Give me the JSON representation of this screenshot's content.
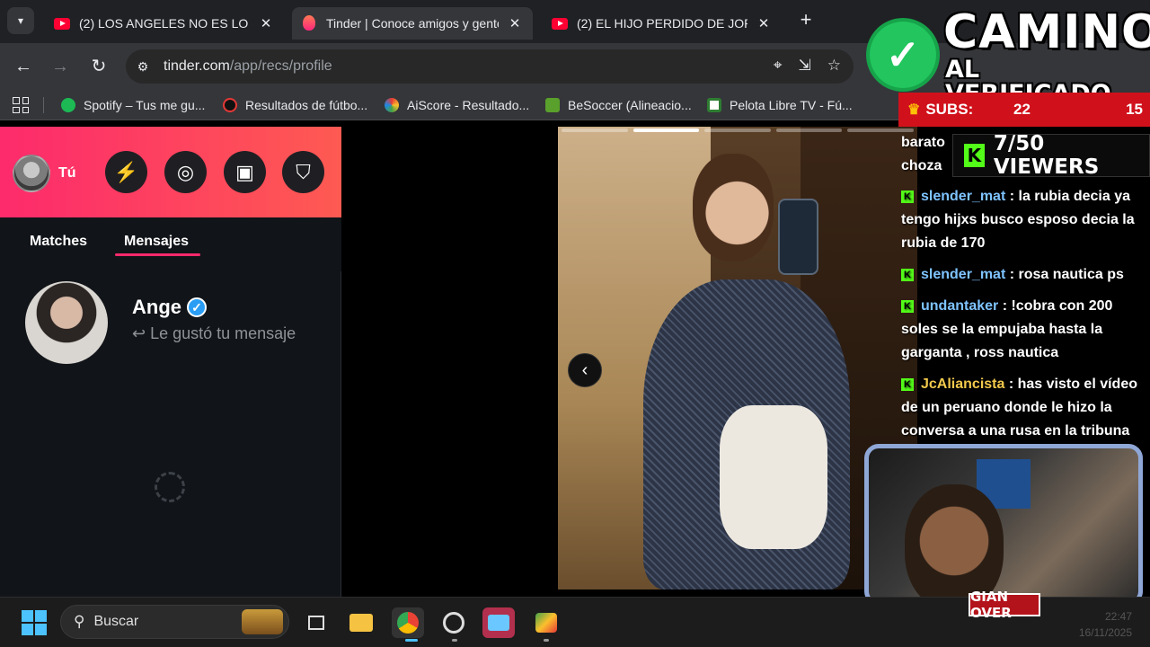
{
  "browser": {
    "tabs": [
      {
        "title": "(2) LOS ANGELES NO ES LO QU",
        "favicon": "youtube-icon",
        "active": false
      },
      {
        "title": "Tinder | Conoce amigos y gente",
        "favicon": "tinder-icon",
        "active": true
      },
      {
        "title": "(2) EL HIJO PERDIDO DE JORGE",
        "favicon": "youtube-icon",
        "active": false
      }
    ],
    "url_host": "tinder.com",
    "url_path": "/app/recs/profile",
    "bookmarks": [
      {
        "label": "Spotify – Tus me gu...",
        "color": "#1db954"
      },
      {
        "label": "Resultados de fútbo...",
        "color": "#222222"
      },
      {
        "label": "AiScore - Resultado...",
        "color": "#ffffff"
      },
      {
        "label": "BeSoccer (Alineacio...",
        "color": "#5aa02c"
      },
      {
        "label": "Pelota Libre TV - Fú...",
        "color": "#ffffff"
      }
    ]
  },
  "tinder": {
    "me_label": "Tú",
    "tabs": [
      "Matches",
      "Mensajes"
    ],
    "active_tab": "Mensajes",
    "conversation": {
      "name": "Ange",
      "preview": "↩ Le gustó tu mensaje",
      "verified": true
    },
    "photo_count": 5,
    "photo_active": 2
  },
  "overlay": {
    "brand_line1": "CAMINO",
    "brand_line2": "AL VERIFICADO",
    "subs_label": "SUBS:",
    "subs_current": "22",
    "subs_goal": "15",
    "viewers": "7/50 VIEWERS",
    "chat": [
      {
        "user": "",
        "text": "barato",
        "gold": false
      },
      {
        "user": "",
        "text": "choza",
        "gold": false
      },
      {
        "user": "slender_mat",
        "text": ": la rubia decia ya tengo hijxs busco esposo decia la rubia de 170",
        "gold": false
      },
      {
        "user": "slender_mat",
        "text": ": rosa nautica ps",
        "gold": false
      },
      {
        "user": "undantaker",
        "text": ": !cobra con 200 soles se la empujaba hasta la garganta , ross nautica",
        "gold": false
      },
      {
        "user": "JcAliancista",
        "text": ": has visto el vídeo de un peruano donde le hizo la conversa a una rusa en la tribuna",
        "gold": true
      }
    ],
    "cam_tag": "GIAN OVER"
  },
  "taskbar": {
    "search_placeholder": "Buscar",
    "time": "22:47",
    "date": "16/11/2025"
  }
}
